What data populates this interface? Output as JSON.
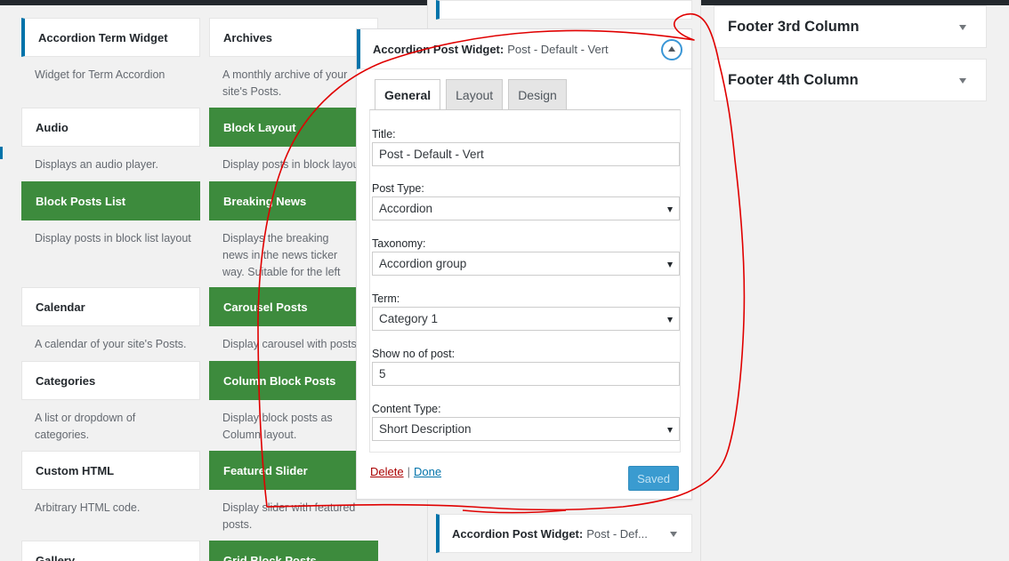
{
  "left_widgets": [
    {
      "title": "Accordion Term Widget",
      "desc": "Widget for Term Accordion",
      "style": "active"
    },
    {
      "title": "Archives",
      "desc": "A monthly archive of your site's Posts.",
      "style": "plain"
    },
    {
      "title": "Audio",
      "desc": "Displays an audio player.",
      "style": "plain"
    },
    {
      "title": "Block Layout",
      "desc": "Display posts in block layout",
      "style": "green"
    },
    {
      "title": "Block Posts List",
      "desc": "Display posts in block list layout",
      "style": "green"
    },
    {
      "title": "Breaking News",
      "desc": "Displays the breaking news in the news ticker way. Suitable for the left and right sidebar",
      "style": "green"
    },
    {
      "title": "Calendar",
      "desc": "A calendar of your site's Posts.",
      "style": "plain"
    },
    {
      "title": "Carousel Posts",
      "desc": "Display carousel with posts.",
      "style": "green"
    },
    {
      "title": "Categories",
      "desc": "A list or dropdown of categories.",
      "style": "plain"
    },
    {
      "title": "Column Block Posts",
      "desc": "Display block posts as Column layout.",
      "style": "green"
    },
    {
      "title": "Custom HTML",
      "desc": "Arbitrary HTML code.",
      "style": "plain"
    },
    {
      "title": "Featured Slider",
      "desc": "Display slider with featured posts.",
      "style": "green"
    },
    {
      "title": "Gallery",
      "desc": "",
      "style": "plain"
    },
    {
      "title": "Grid Block Posts",
      "desc": "",
      "style": "green"
    }
  ],
  "panel": {
    "title_strong": "Accordion Post Widget:",
    "title_sub": "Post - Default - Vert",
    "tabs": [
      {
        "label": "General"
      },
      {
        "label": "Layout"
      },
      {
        "label": "Design"
      }
    ],
    "fields": {
      "title_label": "Title:",
      "title_value": "Post - Default - Vert",
      "post_type_label": "Post Type:",
      "post_type_value": "Accordion",
      "taxonomy_label": "Taxonomy:",
      "taxonomy_value": "Accordion group",
      "term_label": "Term:",
      "term_value": "Category 1",
      "show_label": "Show no of post:",
      "show_value": "5",
      "content_type_label": "Content Type:",
      "content_type_value": "Short Description"
    },
    "delete_label": "Delete",
    "separator": "|",
    "done_label": "Done",
    "saved_label": "Saved"
  },
  "mid_bottom": {
    "title_strong": "Accordion Post Widget:",
    "title_sub": "Post - Def..."
  },
  "sidebars": [
    {
      "label": "Footer 3rd Column"
    },
    {
      "label": "Footer 4th Column"
    }
  ],
  "colors": {
    "accent": "#0073aa",
    "green": "#3d8b3d",
    "annotation": "#e00000",
    "saved": "#3a9bd0"
  }
}
